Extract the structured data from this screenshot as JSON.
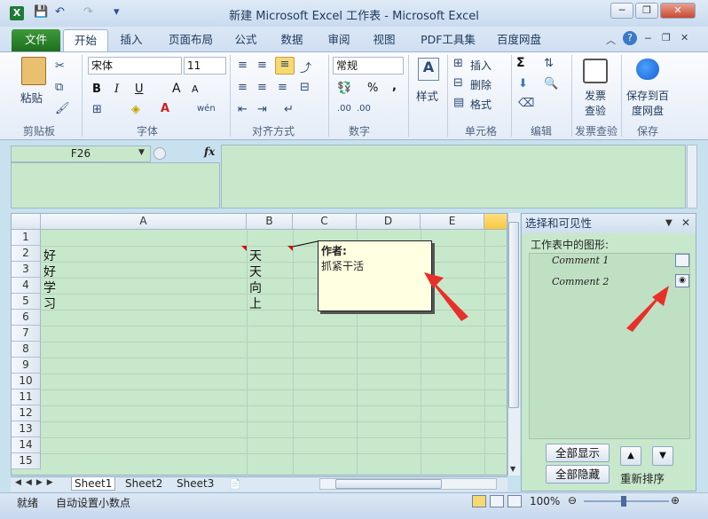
{
  "window": {
    "title": "新建 Microsoft Excel 工作表 - Microsoft Excel"
  },
  "qat": {
    "undo": "↶",
    "redo": "↷",
    "customize": "▾"
  },
  "win_buttons": {
    "minimize": "─",
    "restore": "❐",
    "close": "✕"
  },
  "tabs": [
    {
      "label": "文件"
    },
    {
      "label": "开始"
    },
    {
      "label": "插入"
    },
    {
      "label": "页面布局"
    },
    {
      "label": "公式"
    },
    {
      "label": "数据"
    },
    {
      "label": "审阅"
    },
    {
      "label": "视图"
    },
    {
      "label": "PDF工具集"
    },
    {
      "label": "百度网盘"
    }
  ],
  "ribbon": {
    "paste": "粘贴",
    "font_name": "宋体",
    "font_size": "11",
    "bold": "B",
    "italic": "I",
    "underline": "U",
    "grow": "A",
    "shrink": "A",
    "wen": "wén",
    "number_format": "常规",
    "percent": "%",
    "comma": ",",
    "styles": "样式",
    "insert": "插入",
    "delete": "删除",
    "format": "格式",
    "sigma": "Σ",
    "invoice": "发票\n查验",
    "invoice_l1": "发票",
    "invoice_l2": "查验",
    "save_baidu_l1": "保存到百",
    "save_baidu_l2": "度网盘",
    "dec_inc": ".00",
    "dec_dec": ".00",
    "groups": [
      "剪贴板",
      "字体",
      "对齐方式",
      "数字",
      "单元格",
      "编辑",
      "发票查验",
      "保存"
    ]
  },
  "formula_bar": {
    "name_box": "F26",
    "fx": "fx",
    "value": ""
  },
  "grid": {
    "columns": [
      "A",
      "B",
      "C",
      "D",
      "E"
    ],
    "rows": [
      "1",
      "2",
      "3",
      "4",
      "5",
      "6",
      "7",
      "8",
      "9",
      "10",
      "11",
      "12",
      "13",
      "14",
      "15"
    ],
    "col_a": [
      "好",
      "好",
      "学",
      "习"
    ],
    "col_b": [
      "天",
      "天",
      "向",
      "上"
    ]
  },
  "comment": {
    "author": "作者:",
    "text": "抓紧干活"
  },
  "sheets": [
    "Sheet1",
    "Sheet2",
    "Sheet3"
  ],
  "selection_pane": {
    "title": "选择和可见性",
    "subtitle": "工作表中的图形:",
    "items": [
      {
        "name": "Comment 1"
      },
      {
        "name": "Comment 2"
      }
    ],
    "show_all": "全部显示",
    "hide_all": "全部隐藏",
    "reorder": "重新排序"
  },
  "status": {
    "ready": "就绪",
    "auto_decimal": "自动设置小数点",
    "zoom": "100%"
  },
  "colors": {
    "accent": "#1e6e1e",
    "sheet_bg": "#c8e8cc",
    "arrow": "#e8302a"
  }
}
